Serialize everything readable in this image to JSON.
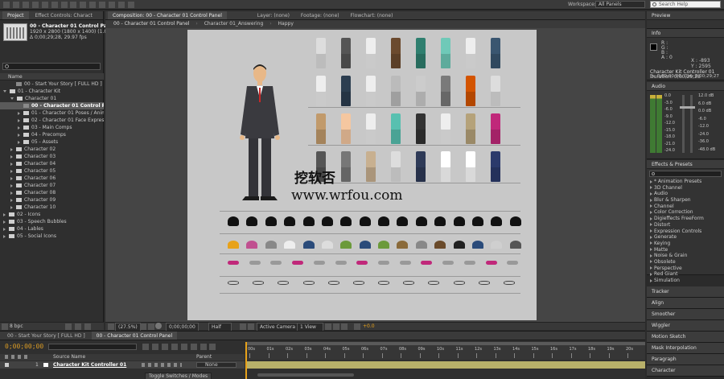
{
  "toolbar": {
    "workspace_label": "Workspace:",
    "workspace_value": "All Panels",
    "search_placeholder": "Search Help"
  },
  "project": {
    "tabs": [
      "Project",
      "Effect Controls: Charact"
    ],
    "thumb_title": "00 - Character 01 Control Panel ▾",
    "thumb_info1": "1920 x 2800 (1800 x 1400) (1.00)",
    "thumb_info2": "Δ 0;00;29;28, 29.97 fps",
    "name_header": "Name",
    "bit_depth": "8 bpc",
    "items": [
      {
        "label": "00 - Start Your Story [ FULL HD ]",
        "indent": 1,
        "type": "comp",
        "open": false
      },
      {
        "label": "01 - Character Kit",
        "indent": 0,
        "type": "folder",
        "open": true
      },
      {
        "label": "Character 01",
        "indent": 1,
        "type": "folder",
        "open": true
      },
      {
        "label": "00 - Character 01 Control Panel",
        "indent": 2,
        "type": "comp",
        "selected": true
      },
      {
        "label": "01 - Character 01 Poses / Animations",
        "indent": 2,
        "type": "folder",
        "open": false
      },
      {
        "label": "02 - Character 01 Face Expressions",
        "indent": 2,
        "type": "folder",
        "open": false
      },
      {
        "label": "03 - Main Comps",
        "indent": 2,
        "type": "folder",
        "open": false
      },
      {
        "label": "04 - Precomps",
        "indent": 2,
        "type": "folder",
        "open": false
      },
      {
        "label": "05 - Assets",
        "indent": 2,
        "type": "folder",
        "open": false
      },
      {
        "label": "Character 02",
        "indent": 1,
        "type": "folder",
        "open": false
      },
      {
        "label": "Character 03",
        "indent": 1,
        "type": "folder",
        "open": false
      },
      {
        "label": "Character 04",
        "indent": 1,
        "type": "folder",
        "open": false
      },
      {
        "label": "Character 05",
        "indent": 1,
        "type": "folder",
        "open": false
      },
      {
        "label": "Character 06",
        "indent": 1,
        "type": "folder",
        "open": false
      },
      {
        "label": "Character 07",
        "indent": 1,
        "type": "folder",
        "open": false
      },
      {
        "label": "Character 08",
        "indent": 1,
        "type": "folder",
        "open": false
      },
      {
        "label": "Character 09",
        "indent": 1,
        "type": "folder",
        "open": false
      },
      {
        "label": "Character 10",
        "indent": 1,
        "type": "folder",
        "open": false
      },
      {
        "label": "02 - Icons",
        "indent": 0,
        "type": "folder",
        "open": false
      },
      {
        "label": "03 - Speech Bubbles",
        "indent": 0,
        "type": "folder",
        "open": false
      },
      {
        "label": "04 - Lables",
        "indent": 0,
        "type": "folder",
        "open": false
      },
      {
        "label": "05 - Social Icons",
        "indent": 0,
        "type": "folder",
        "open": false
      }
    ]
  },
  "composition": {
    "tabs": [
      "Composition: 00 - Character 01 Control Panel",
      "Layer: (none)",
      "Footage: (none)",
      "Flowchart: (none)"
    ],
    "breadcrumbs": [
      "00 - Character 01 Control Panel",
      "Character 01_Answering",
      "Happy"
    ],
    "zoom": "(27.5%)",
    "timecode": "0;00;00;00",
    "resolution": "Half",
    "camera": "Active Camera",
    "views": "1 View",
    "exposure": "+0.0"
  },
  "watermark": {
    "line1": "挖软否",
    "line2": "www.wrfou.com"
  },
  "preview": {
    "title": "Preview"
  },
  "info": {
    "title": "Info",
    "r": "R :",
    "g": "G :",
    "b": "B :",
    "a": "A : 0",
    "x": "X : -893",
    "y": "Y : 2595",
    "layer": "Character Kit Controller 01",
    "duration": "Duration: 0;00;29;28",
    "inout": "In: 0;00;00;00, Out: 0;00;29;27"
  },
  "audio": {
    "title": "Audio",
    "left_scale": [
      "0.0",
      "-3.0",
      "-6.0",
      "-9.0",
      "-12.0",
      "-15.0",
      "-18.0",
      "-21.0",
      "-24.0"
    ],
    "right_scale": [
      "12.0 dB",
      "6.0 dB",
      "0.0 dB",
      "-6.0",
      "-12.0",
      "-24.0",
      "-36.0",
      "-48.0 dB"
    ]
  },
  "effects": {
    "title": "Effects & Presets",
    "items": [
      "* Animation Presets",
      "3D Channel",
      "Audio",
      "Blur & Sharpen",
      "Channel",
      "Color Correction",
      "Digieffects FreeForm",
      "Distort",
      "Expression Controls",
      "Generate",
      "Keying",
      "Matte",
      "Noise & Grain",
      "Obsolete",
      "Perspective",
      "Red Giant",
      "Simulation"
    ]
  },
  "side_panels": [
    "Tracker",
    "Align",
    "Smoother",
    "Wiggler",
    "Motion Sketch",
    "Mask Interpolation",
    "Paragraph",
    "Character"
  ],
  "timeline": {
    "tabs": [
      "00 - Start Your Story [ FULL HD ]",
      "00 - Character 01 Control Panel"
    ],
    "timecode": "0;00;00;00",
    "source_header": "Source Name",
    "parent_header": "Parent",
    "layer_number": "1",
    "layer_name": "Character Kit Controller 01",
    "parent_value": "None",
    "ruler": [
      "00s",
      "01s",
      "02s",
      "03s",
      "04s",
      "05s",
      "06s",
      "07s",
      "08s",
      "09s",
      "10s",
      "11s",
      "12s",
      "13s",
      "14s",
      "15s",
      "16s",
      "17s",
      "18s",
      "19s",
      "20s"
    ],
    "toggle_label": "Toggle Switches / Modes"
  },
  "colors": {
    "accent": "#e8a21a",
    "timecode": "#d89a24",
    "bar": "#b8b06a",
    "canvas": "#c8c8c8",
    "meter": "#4a8a3a"
  }
}
